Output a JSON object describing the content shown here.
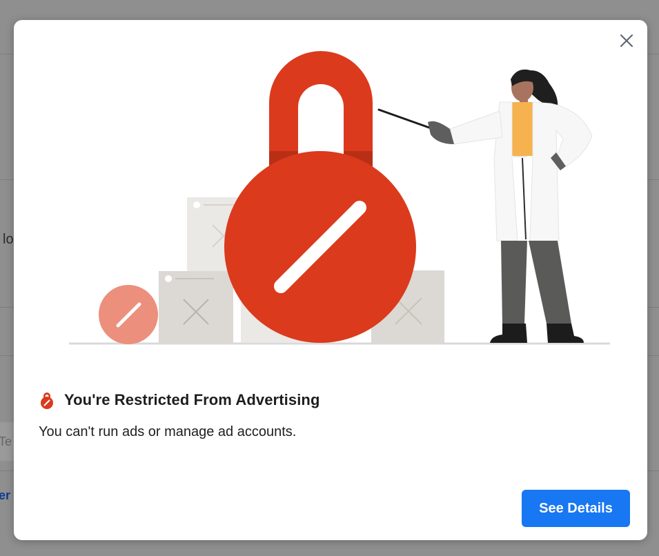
{
  "background_page": {
    "fragment_left_1": "lo",
    "fragment_left_2": "Te",
    "fragment_left_3": "er"
  },
  "modal": {
    "close_icon": "close-icon",
    "title_icon": "lock-icon",
    "title": "You're Restricted From Advertising",
    "subtitle": "You can't run ads or manage ad accounts.",
    "primary_button_label": "See Details"
  },
  "colors": {
    "accent_blue": "#1877f2",
    "lock_red": "#db3a1d",
    "lock_red_dark": "#b92f16",
    "badge_salmon": "#ec8f7c",
    "box_grey": "#d9d5d0",
    "shirt_yellow": "#f6b24e",
    "overlay_grey": "#8f8f8f"
  }
}
